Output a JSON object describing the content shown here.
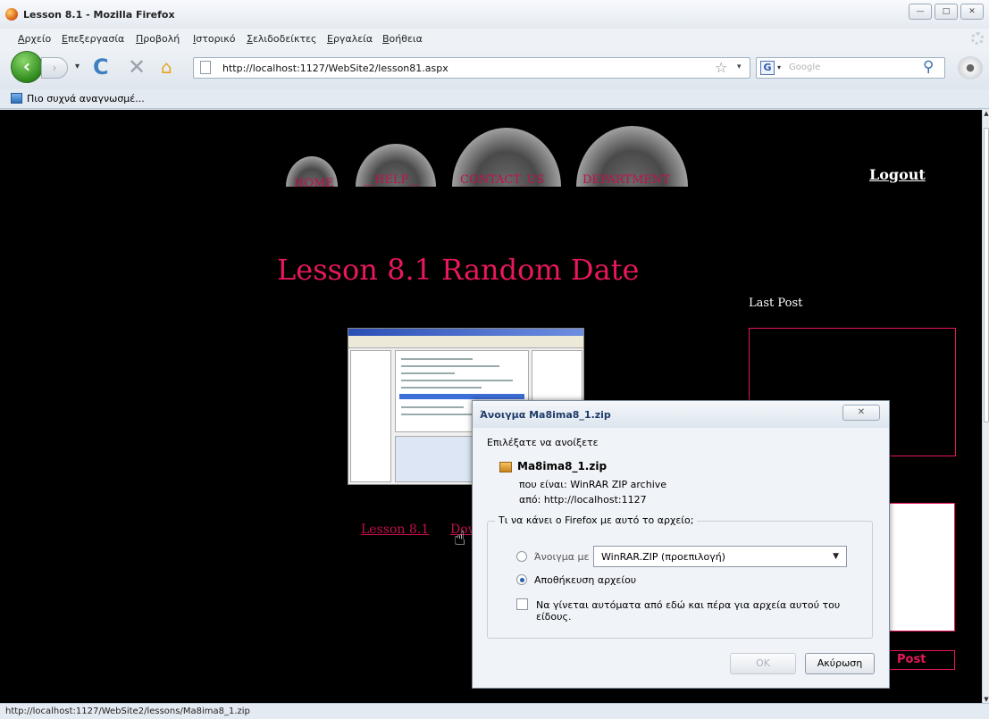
{
  "window": {
    "title": "Lesson 8.1 - Mozilla Firefox",
    "controls": {
      "minimize": "—",
      "maximize": "□",
      "close": "✕"
    }
  },
  "menu": [
    "Αρχείο",
    "Επεξεργασία",
    "Προβολή",
    "Ιστορικό",
    "Σελιδοδείκτες",
    "Εργαλεία",
    "Βοήθεια"
  ],
  "nav": {
    "back": "‹",
    "forward": "›",
    "history_dropdown": "▾",
    "reload": "C",
    "stop": "✕",
    "home": "⌂",
    "url": "http://localhost:1127/WebSite2/lesson81.aspx",
    "bookmark_star": "☆",
    "url_dropdown": "▾",
    "search_engine": "G",
    "search_engine_dropdown": "▾",
    "search_placeholder": "Google",
    "search_icon": "⚲",
    "addon": "●"
  },
  "bookmarks": {
    "most_visited": "Πιο συχνά αναγνωσμέ..."
  },
  "page": {
    "nav_items": [
      "HOME",
      "__HELP__",
      "CONTACT_US",
      "DEPARTMENT"
    ],
    "logout": "Logout",
    "heading": "Lesson 8.1 Random Date",
    "last_post_label": "Last Post",
    "lesson_link": "Lesson 8.1",
    "download_link_visible": "Dow",
    "post_button": "Post",
    "colors": {
      "accent": "#e8185a",
      "nav_text": "#c2104a",
      "background": "#000000"
    }
  },
  "dialog": {
    "title": "Άνοιγμα Ma8ima8_1.zip",
    "close": "✕",
    "prompt": "Επιλέξατε να ανοίξετε",
    "file_name": "Ma8ima8_1.zip",
    "file_type_label": "που είναι:",
    "file_type": "WinRAR ZIP archive",
    "from_label": "από:",
    "from": "http://localhost:1127",
    "question": "Τι να κάνει ο Firefox  με αυτό το αρχείο;",
    "open_with_label": "Άνοιγμα με",
    "open_with_app": "WinRAR.ZIP (προεπιλογή)",
    "save_label": "Αποθήκευση αρχείου",
    "auto_label": "Να γίνεται αυτόματα από εδώ και πέρα για αρχεία αυτού του είδους.",
    "ok": "OK",
    "cancel": "Ακύρωση",
    "selected_option": "save"
  },
  "status": {
    "text": "http://localhost:1127/WebSite2/lessons/Ma8ima8_1.zip"
  }
}
